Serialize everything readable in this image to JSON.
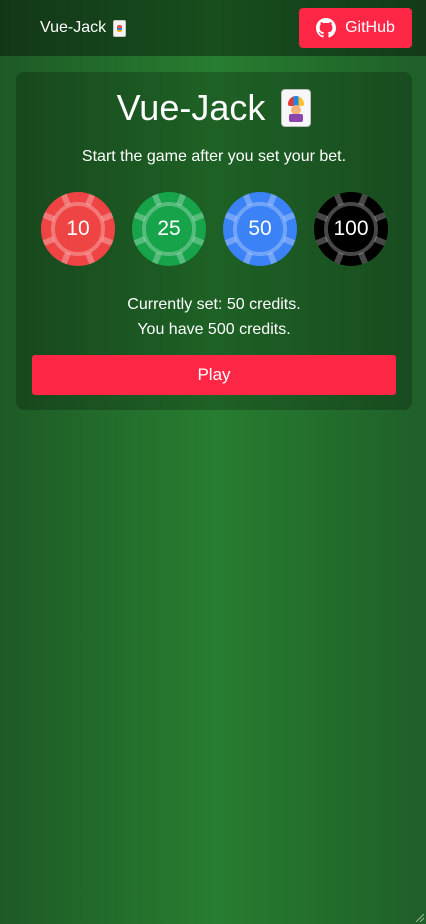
{
  "nav": {
    "brand": "Vue-Jack",
    "github_label": "GitHub"
  },
  "game": {
    "title": "Vue-Jack",
    "subtitle": "Start the game after you set your bet.",
    "chips": [
      {
        "label": "10",
        "value": 10,
        "color": "#ef4444"
      },
      {
        "label": "25",
        "value": 25,
        "color": "#16a34a"
      },
      {
        "label": "50",
        "value": 50,
        "color": "#3b82f6"
      },
      {
        "label": "100",
        "value": 100,
        "color": "#000000"
      }
    ],
    "current_bet": "Currently set: 50 credits.",
    "balance": "You have 500 credits.",
    "play_label": "Play"
  },
  "colors": {
    "accent": "#ff2745",
    "felt": "#277d30"
  }
}
